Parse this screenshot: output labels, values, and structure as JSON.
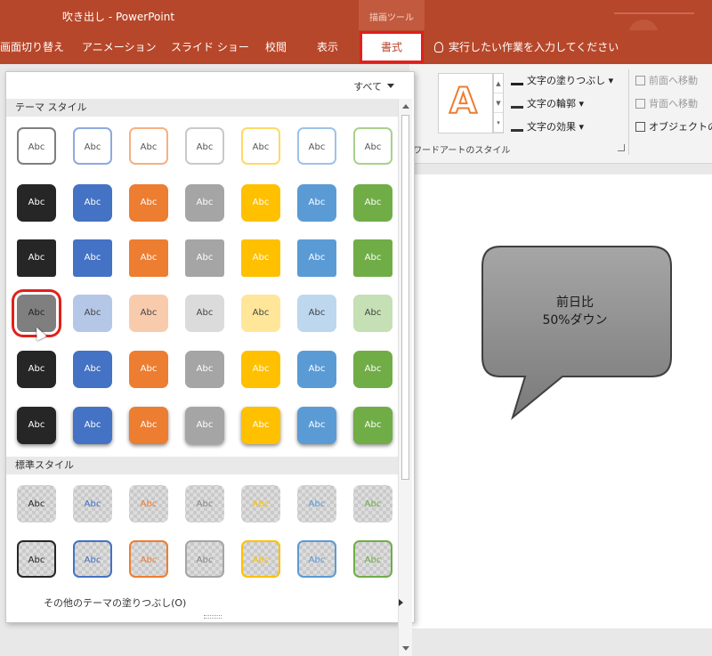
{
  "window": {
    "title": "吹き出し - PowerPoint",
    "context_tab_group": "描画ツール"
  },
  "tabs": [
    {
      "label": "画面切り替え",
      "active": false
    },
    {
      "label": "アニメーション",
      "active": false
    },
    {
      "label": "スライド ショー",
      "active": false
    },
    {
      "label": "校閲",
      "active": false
    },
    {
      "label": "表示",
      "active": false
    },
    {
      "label": "書式",
      "active": true
    }
  ],
  "tell_me": {
    "placeholder": "実行したい作業を入力してください"
  },
  "ribbon": {
    "wordart_sample": "A",
    "text_fill": "文字の塗りつぶし",
    "text_outline": "文字の輪郭",
    "text_effects": "文字の効果",
    "group_label": "ワードアートのスタイル",
    "bring_forward": "前面へ移動",
    "send_backward": "背面へ移動",
    "selection_pane": "オブジェクトの"
  },
  "gallery": {
    "filter": "すべて",
    "theme_section": "テーマ スタイル",
    "standard_section": "標準スタイル",
    "swatch_text": "Abc",
    "more_fills_link": "その他のテーマの塗りつぶし(O)"
  },
  "colors": {
    "accents": [
      "#262626",
      "#4472c4",
      "#ed7d31",
      "#a5a5a5",
      "#ffc000",
      "#5b9bd5",
      "#70ad47"
    ],
    "soft": [
      "#7f7f7f",
      "#b4c7e7",
      "#f8cbad",
      "#dbdbdb",
      "#ffe699",
      "#bdd7ee",
      "#c5e0b4"
    ],
    "outline_light": [
      "#7f7f7f",
      "#8faadc",
      "#f4b183",
      "#c9c9c9",
      "#ffd966",
      "#9dc3e6",
      "#a9d18e"
    ]
  },
  "slide": {
    "bubble_line1": "前日比",
    "bubble_line2": "50%ダウン"
  }
}
